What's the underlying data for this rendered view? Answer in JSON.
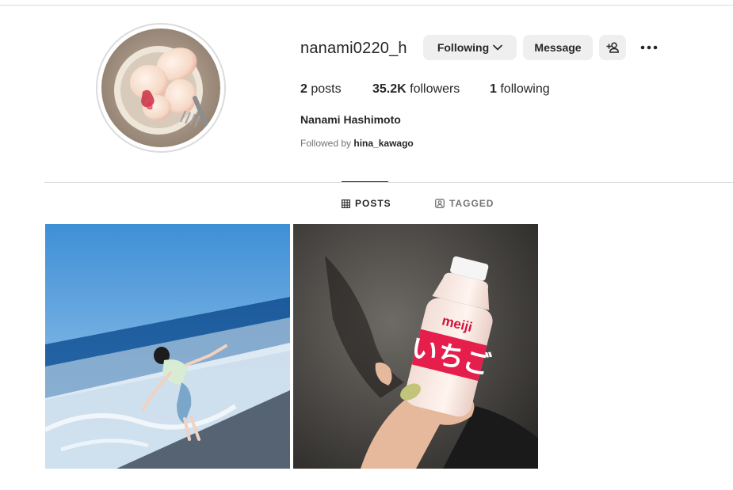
{
  "profile": {
    "username": "nanami0220_h",
    "full_name": "Nanami Hashimoto",
    "followed_by_prefix": "Followed by",
    "followed_by_user": "hina_kawago",
    "avatar_icon": "avatar-peaches-photo"
  },
  "actions": {
    "following_label": "Following",
    "message_label": "Message",
    "add_user_icon": "add-user-icon",
    "more_icon": "more-options-icon"
  },
  "stats": {
    "posts_count": "2",
    "posts_label": "posts",
    "followers_count": "35.2K",
    "followers_label": "followers",
    "following_count": "1",
    "following_label": "following"
  },
  "tabs": [
    {
      "label": "POSTS",
      "icon": "grid-icon",
      "active": true
    },
    {
      "label": "TAGGED",
      "icon": "tagged-icon",
      "active": false
    }
  ],
  "posts": [
    {
      "subject": "girl-on-beach-photo",
      "multiple": true,
      "badge_icon": "carousel-icon"
    },
    {
      "subject": "meiji-strawberry-milk-bottle-photo",
      "multiple": false
    }
  ],
  "bottle": {
    "brand": "meiji",
    "label": "いちご"
  },
  "colors": {
    "button_bg": "#efefef",
    "text": "#262626",
    "muted": "#737373",
    "divider": "#dbdbdb"
  }
}
